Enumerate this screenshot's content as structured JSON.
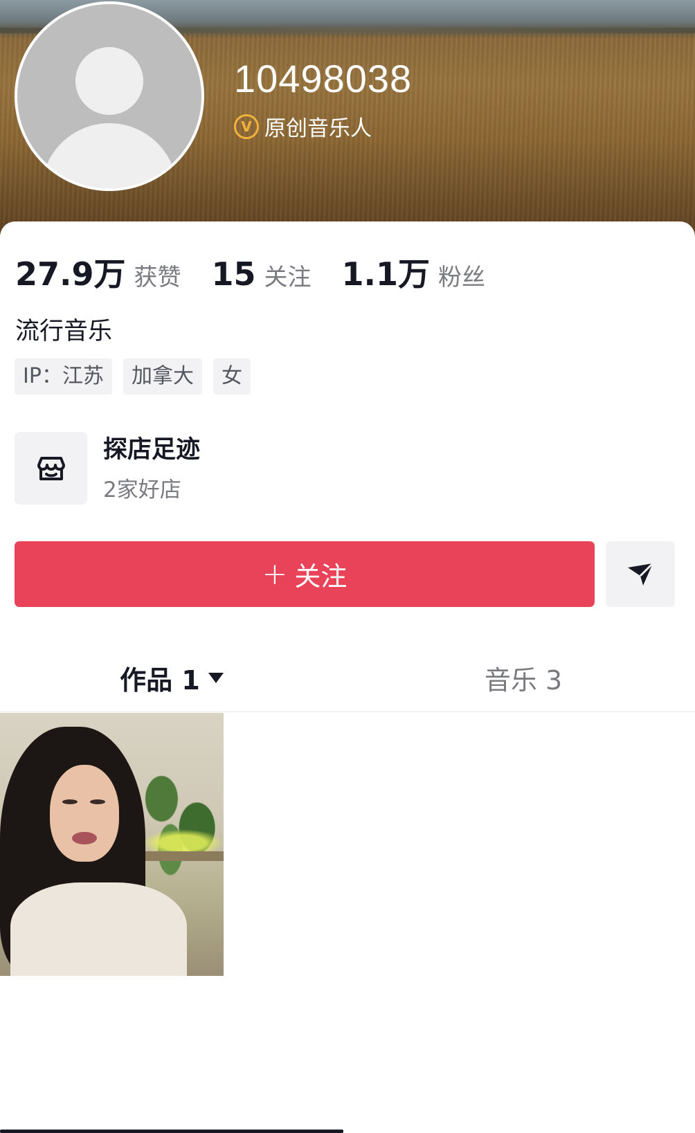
{
  "profile": {
    "username": "10498038",
    "verified_label": "原创音乐人",
    "verified_badge": "V",
    "avatar_icon": "default-avatar-icon"
  },
  "stats": {
    "likes_value": "27.9万",
    "likes_label": "获赞",
    "following_value": "15",
    "following_label": "关注",
    "followers_value": "1.1万",
    "followers_label": "粉丝"
  },
  "bio": "流行音乐",
  "tags": [
    "IP：江苏",
    "加拿大",
    "女"
  ],
  "shop": {
    "icon": "store-icon",
    "title": "探店足迹",
    "subtitle": "2家好店"
  },
  "actions": {
    "follow_plus": "+",
    "follow_label": "关注",
    "share_icon": "send-icon"
  },
  "tabs": {
    "works_label": "作品 1",
    "music_label": "音乐 3"
  },
  "colors": {
    "follow_button": "#e9435a",
    "verified_badge": "#f2b33d",
    "text_primary": "#161823",
    "text_secondary": "#7a7b80",
    "chip_bg": "#f2f2f4"
  }
}
